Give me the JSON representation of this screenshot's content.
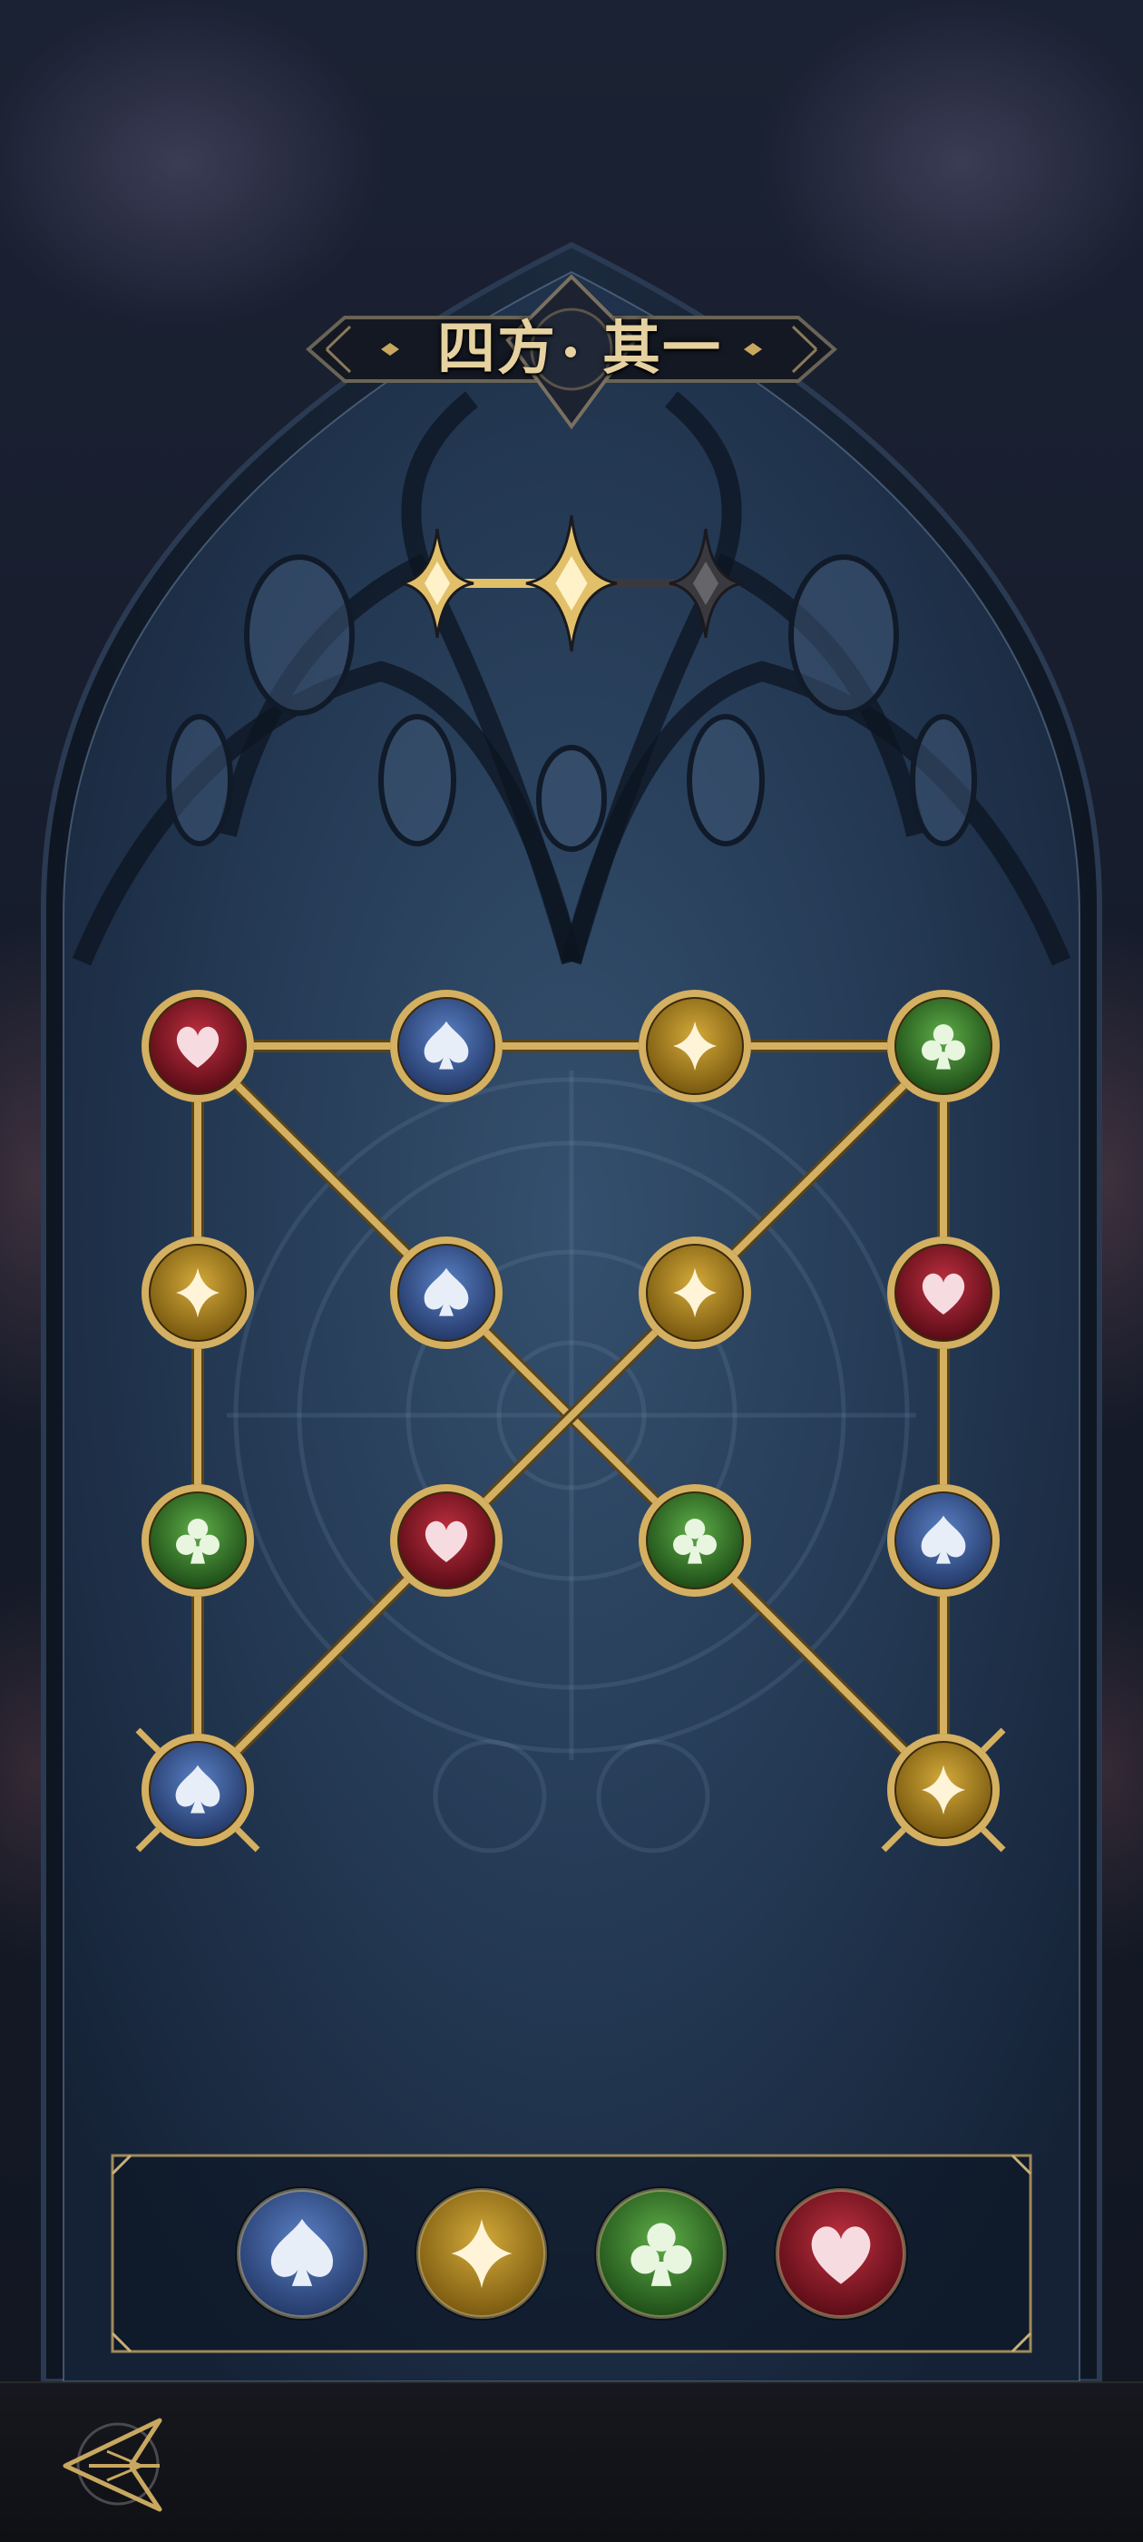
{
  "level": {
    "title_left": "四方",
    "title_right": "其一",
    "stars_total": 3,
    "stars_earned": 2
  },
  "colors": {
    "spade": "#3a5ea0",
    "diamond": "#b08a22",
    "club": "#3e8a32",
    "heart": "#9a1e2a",
    "gold": "#d4b062",
    "star_active": "#e2c06a",
    "star_inactive": "#3a3a3e"
  },
  "board": {
    "nodes": [
      {
        "id": "a1",
        "suit": "heart"
      },
      {
        "id": "a2",
        "suit": "spade"
      },
      {
        "id": "a3",
        "suit": "diamond"
      },
      {
        "id": "a4",
        "suit": "club"
      },
      {
        "id": "b1",
        "suit": "diamond"
      },
      {
        "id": "b2",
        "suit": "spade"
      },
      {
        "id": "b3",
        "suit": "diamond"
      },
      {
        "id": "b4",
        "suit": "heart"
      },
      {
        "id": "c1",
        "suit": "club"
      },
      {
        "id": "c2",
        "suit": "heart"
      },
      {
        "id": "c3",
        "suit": "club"
      },
      {
        "id": "c4",
        "suit": "spade"
      },
      {
        "id": "d1",
        "suit": "spade",
        "endpoint": true
      },
      {
        "id": "d4",
        "suit": "diamond",
        "endpoint": true
      }
    ],
    "edges": [
      [
        "a1",
        "a2"
      ],
      [
        "a2",
        "a3"
      ],
      [
        "a3",
        "a4"
      ],
      [
        "a1",
        "b1"
      ],
      [
        "b1",
        "c1"
      ],
      [
        "c1",
        "d1"
      ],
      [
        "a4",
        "b4"
      ],
      [
        "b4",
        "c4"
      ],
      [
        "c4",
        "d4"
      ],
      [
        "a1",
        "b2"
      ],
      [
        "b2",
        "c3"
      ],
      [
        "c3",
        "d4"
      ],
      [
        "a4",
        "b3"
      ],
      [
        "b3",
        "c2"
      ],
      [
        "c2",
        "d1"
      ]
    ]
  },
  "palette": {
    "tokens": [
      {
        "suit": "spade",
        "label": "spade"
      },
      {
        "suit": "diamond",
        "label": "diamond"
      },
      {
        "suit": "club",
        "label": "club"
      },
      {
        "suit": "heart",
        "label": "heart"
      }
    ]
  }
}
